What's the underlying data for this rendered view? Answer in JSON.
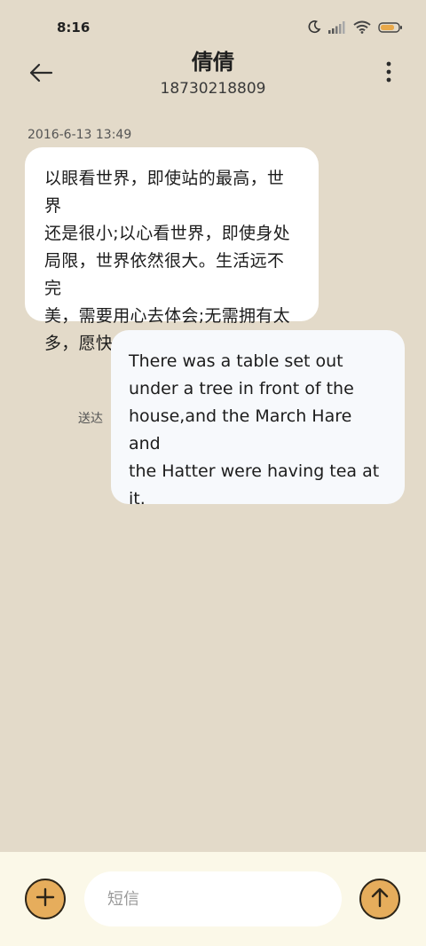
{
  "status_bar": {
    "time": "8:16",
    "icons": [
      "moon-icon",
      "signal-icon",
      "wifi-icon",
      "battery-icon"
    ]
  },
  "header": {
    "contact_name": "倩倩",
    "contact_number": "18730218809",
    "back_icon": "back-arrow-icon",
    "more_icon": "more-vertical-icon"
  },
  "conversation": {
    "timestamp": "2016-6-13 13:49",
    "incoming": {
      "lines": [
        "以眼看世界，即使站的最高，世界",
        "还是很小;以心看世界，即使身处",
        "局限，世界依然很大。生活远不完",
        "美，需要用心去体会;无需拥有太",
        "多，愿快乐与你相随。"
      ]
    },
    "outgoing": {
      "lines": [
        "There was a table set out",
        "under a tree in front of the",
        "house,and the March Hare and",
        "the Hatter were having tea at",
        "it."
      ],
      "status": "送达"
    }
  },
  "compose": {
    "placeholder": "短信",
    "value": "",
    "add_icon": "plus-icon",
    "send_icon": "send-arrow-icon"
  },
  "colors": {
    "background": "#e3dac9",
    "input_bar": "#fbf8e8",
    "accent": "#e6ad5c",
    "incoming_bubble": "#ffffff",
    "outgoing_bubble": "#f7f9fc"
  }
}
